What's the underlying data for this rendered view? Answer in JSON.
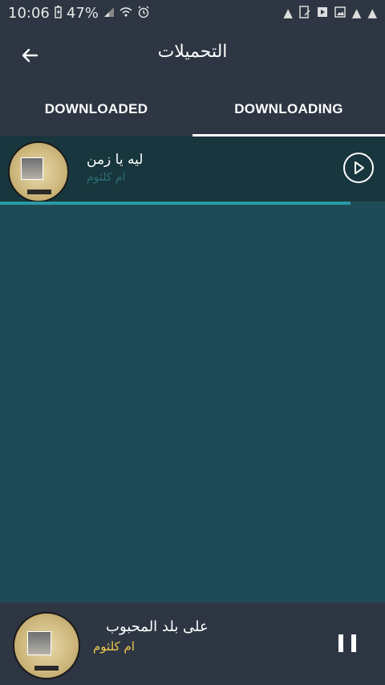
{
  "statusbar": {
    "time": "10:06",
    "battery": "47%",
    "icons": [
      "battery-icon",
      "signal-icon",
      "wifi-icon",
      "alarm-icon",
      "warning-icon",
      "file-icon",
      "media-icon",
      "image-icon",
      "warning-icon",
      "warning-icon"
    ]
  },
  "appbar": {
    "title": "التحميلات",
    "back_icon": "arrow-left-icon"
  },
  "tabs": [
    {
      "label": "DOWNLOADED",
      "active": false
    },
    {
      "label": "DOWNLOADING",
      "active": true
    }
  ],
  "downloading": {
    "items": [
      {
        "title": "ليه يا زمن",
        "artist": "ام كلثوم",
        "progress": 0.91
      }
    ]
  },
  "player": {
    "title": "على بلد المحبوب",
    "artist": "ام كلثوم",
    "state": "playing"
  },
  "colors": {
    "bar_bg": "#2d3642",
    "content_bg": "#1f4b57",
    "row_bg": "#18363d",
    "progress": "#2a9aa6",
    "artist_text": "#f2c94c"
  }
}
